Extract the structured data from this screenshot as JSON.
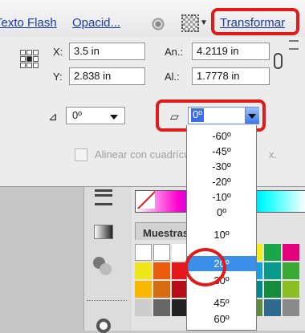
{
  "toolbar": {
    "flash_link": "Texto Flash",
    "opacity_link": "Opacid...",
    "transform_link": "Transformar"
  },
  "transform": {
    "x_label": "X:",
    "x_value": "3.5 in",
    "y_label": "Y:",
    "y_value": "2.838 in",
    "w_label": "An.:",
    "w_value": "4.2119 in",
    "h_label": "Al.:",
    "h_value": "1.7778 in",
    "rotate_icon": "⊿",
    "rotate_value": "0º",
    "shear_icon": "▱",
    "shear_value": "0º",
    "align_label": "Alinear con cuadrícula de píxeles",
    "align_tail": "x."
  },
  "shear_options": [
    "-60º",
    "-45º",
    "-30º",
    "-20º",
    "-10º",
    "0º",
    "10º",
    "20º",
    "30º",
    "45º",
    "60º"
  ],
  "selected_option_index": 7,
  "swatches": {
    "tab_label": "Muestras"
  },
  "colors": {
    "highlight": "#e21a1a",
    "link": "#1a3cab",
    "selection": "#3b8fe8"
  }
}
